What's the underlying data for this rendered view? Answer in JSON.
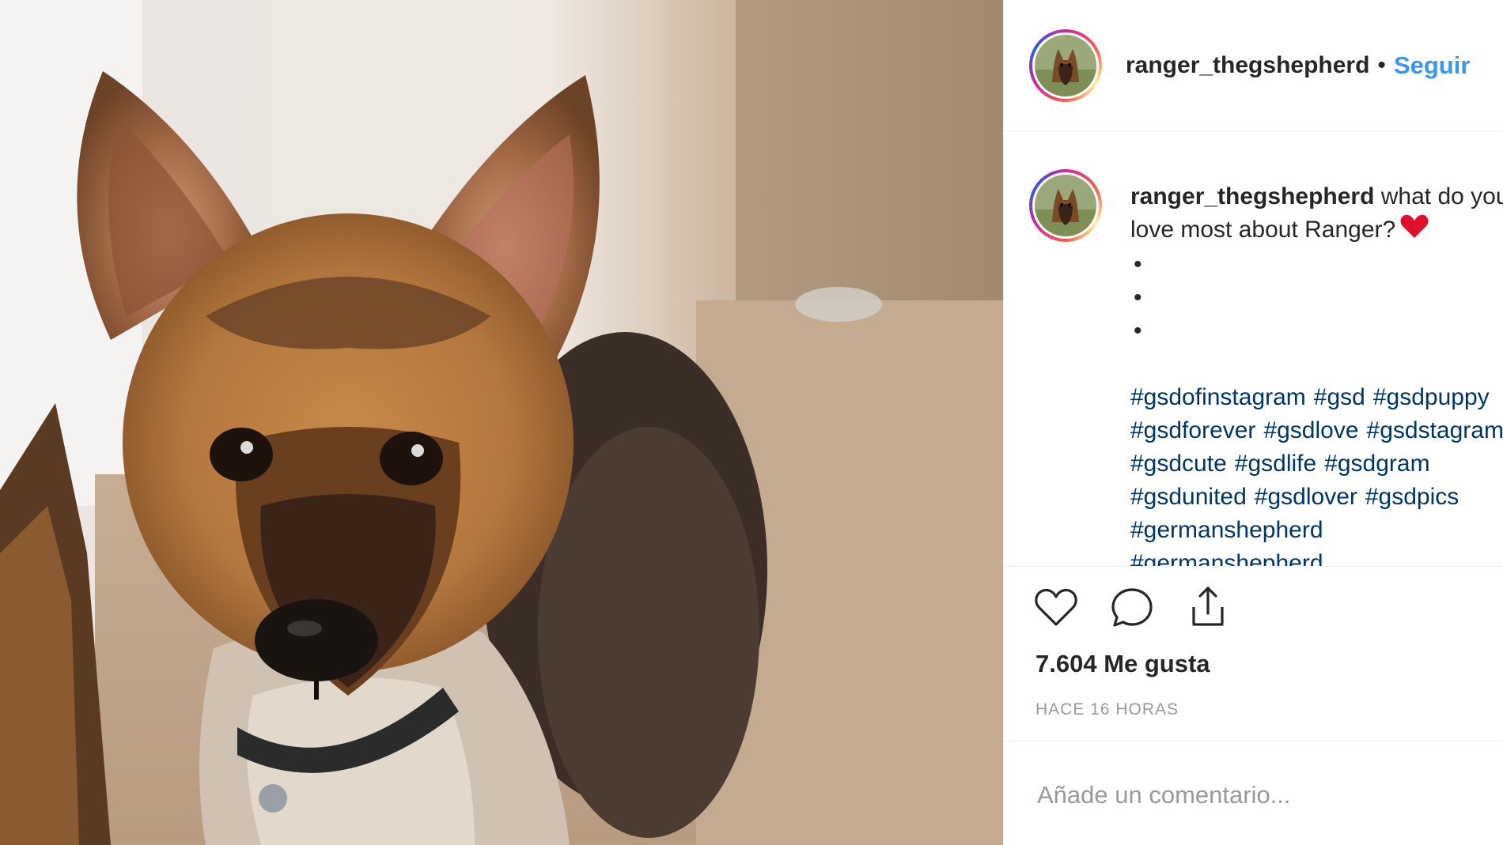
{
  "post": {
    "username": "ranger_thegshepherd",
    "separator": "•",
    "follow_label": "Seguir"
  },
  "caption": {
    "username": "ranger_thegshepherd",
    "text": " what do you love most about Ranger?",
    "bullets": [
      "•",
      "•",
      "•"
    ],
    "hashtags": [
      "#gsdofinstagram",
      "#gsd",
      "#gsdpuppy",
      "#gsdforever",
      "#gsdlove",
      "#gsdstagram",
      "#gsdcute",
      "#gsdlife",
      "#gsdgram",
      "#gsdunited",
      "#gsdlover",
      "#gsdpics",
      "#germanshepherd",
      "#germanshepherd"
    ]
  },
  "actions": {
    "like_icon": "heart-outline-icon",
    "comment_icon": "comment-bubble-icon",
    "share_icon": "share-upload-icon"
  },
  "stats": {
    "likes": "7.604 Me gusta",
    "time": "HACE 16 HORAS"
  },
  "comment": {
    "placeholder": "Añade un comentario..."
  },
  "colors": {
    "link": "#3897f0",
    "hashtag": "#003569",
    "heart_emoji": "#e0102b",
    "muted": "#999999"
  }
}
